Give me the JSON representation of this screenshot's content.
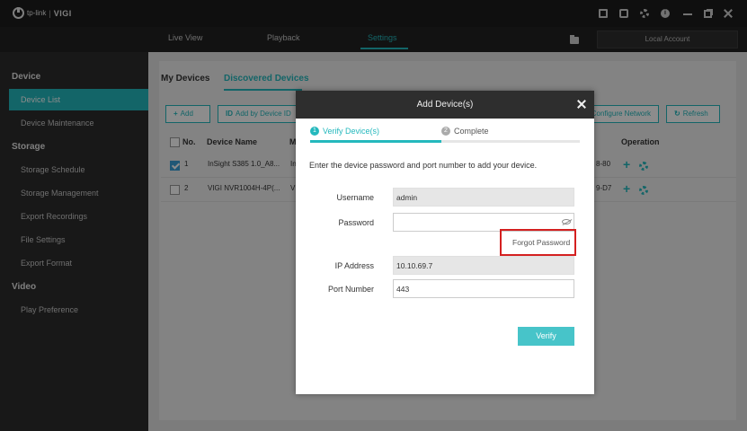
{
  "titlebar": {
    "brand": "tp-link",
    "separator": "|",
    "product": "VIGI",
    "icons": [
      "save-icon",
      "chip-icon",
      "settings-gear-icon",
      "info-icon",
      "minimize-icon",
      "restore-icon",
      "close-icon"
    ]
  },
  "nav": {
    "tabs": [
      {
        "label": "Live View",
        "active": false
      },
      {
        "label": "Playback",
        "active": false
      },
      {
        "label": "Settings",
        "active": true
      }
    ],
    "account": "Local Account",
    "accent_color": "#24b8bd"
  },
  "sidebar": {
    "groups": [
      {
        "label": "Device",
        "items": [
          "Device List",
          "Device Maintenance"
        ]
      },
      {
        "label": "Storage",
        "items": [
          "Storage Schedule",
          "Storage Management",
          "Export Recordings",
          "File Settings",
          "Export Format"
        ]
      },
      {
        "label": "Video",
        "items": [
          "Play Preference"
        ]
      }
    ],
    "active_item": "Device List"
  },
  "main": {
    "tabs": [
      {
        "label": "My Devices",
        "active": false
      },
      {
        "label": "Discovered Devices",
        "active": true
      }
    ],
    "toolbar": {
      "add": "Add",
      "add_by_id": "Add by Device ID",
      "configure_network": "Configure Network",
      "refresh": "Refresh"
    },
    "table": {
      "headers": [
        "No.",
        "Device Name",
        "M",
        "Operation"
      ],
      "rows": [
        {
          "checked": true,
          "no": "1",
          "name": "InSight S385 1.0_A8...",
          "model": "In",
          "mac": "8-80"
        },
        {
          "checked": false,
          "no": "2",
          "name": "VIGI NVR1004H-4P(...",
          "model": "V",
          "mac": "9-D7"
        }
      ]
    }
  },
  "dialog": {
    "title": "Add Device(s)",
    "steps": [
      {
        "num": "1",
        "label": "Verify Device(s)",
        "active": true
      },
      {
        "num": "2",
        "label": "Complete",
        "active": false
      }
    ],
    "instruction": "Enter the device password and port number to add your device.",
    "fields": {
      "username": {
        "label": "Username",
        "value": "admin"
      },
      "password": {
        "label": "Password",
        "value": ""
      },
      "ip": {
        "label": "IP Address",
        "value": "10.10.69.7"
      },
      "port": {
        "label": "Port Number",
        "value": "443"
      }
    },
    "forgot_password": "Forgot Password",
    "verify_button": "Verify",
    "highlight_color": "#d42020"
  }
}
